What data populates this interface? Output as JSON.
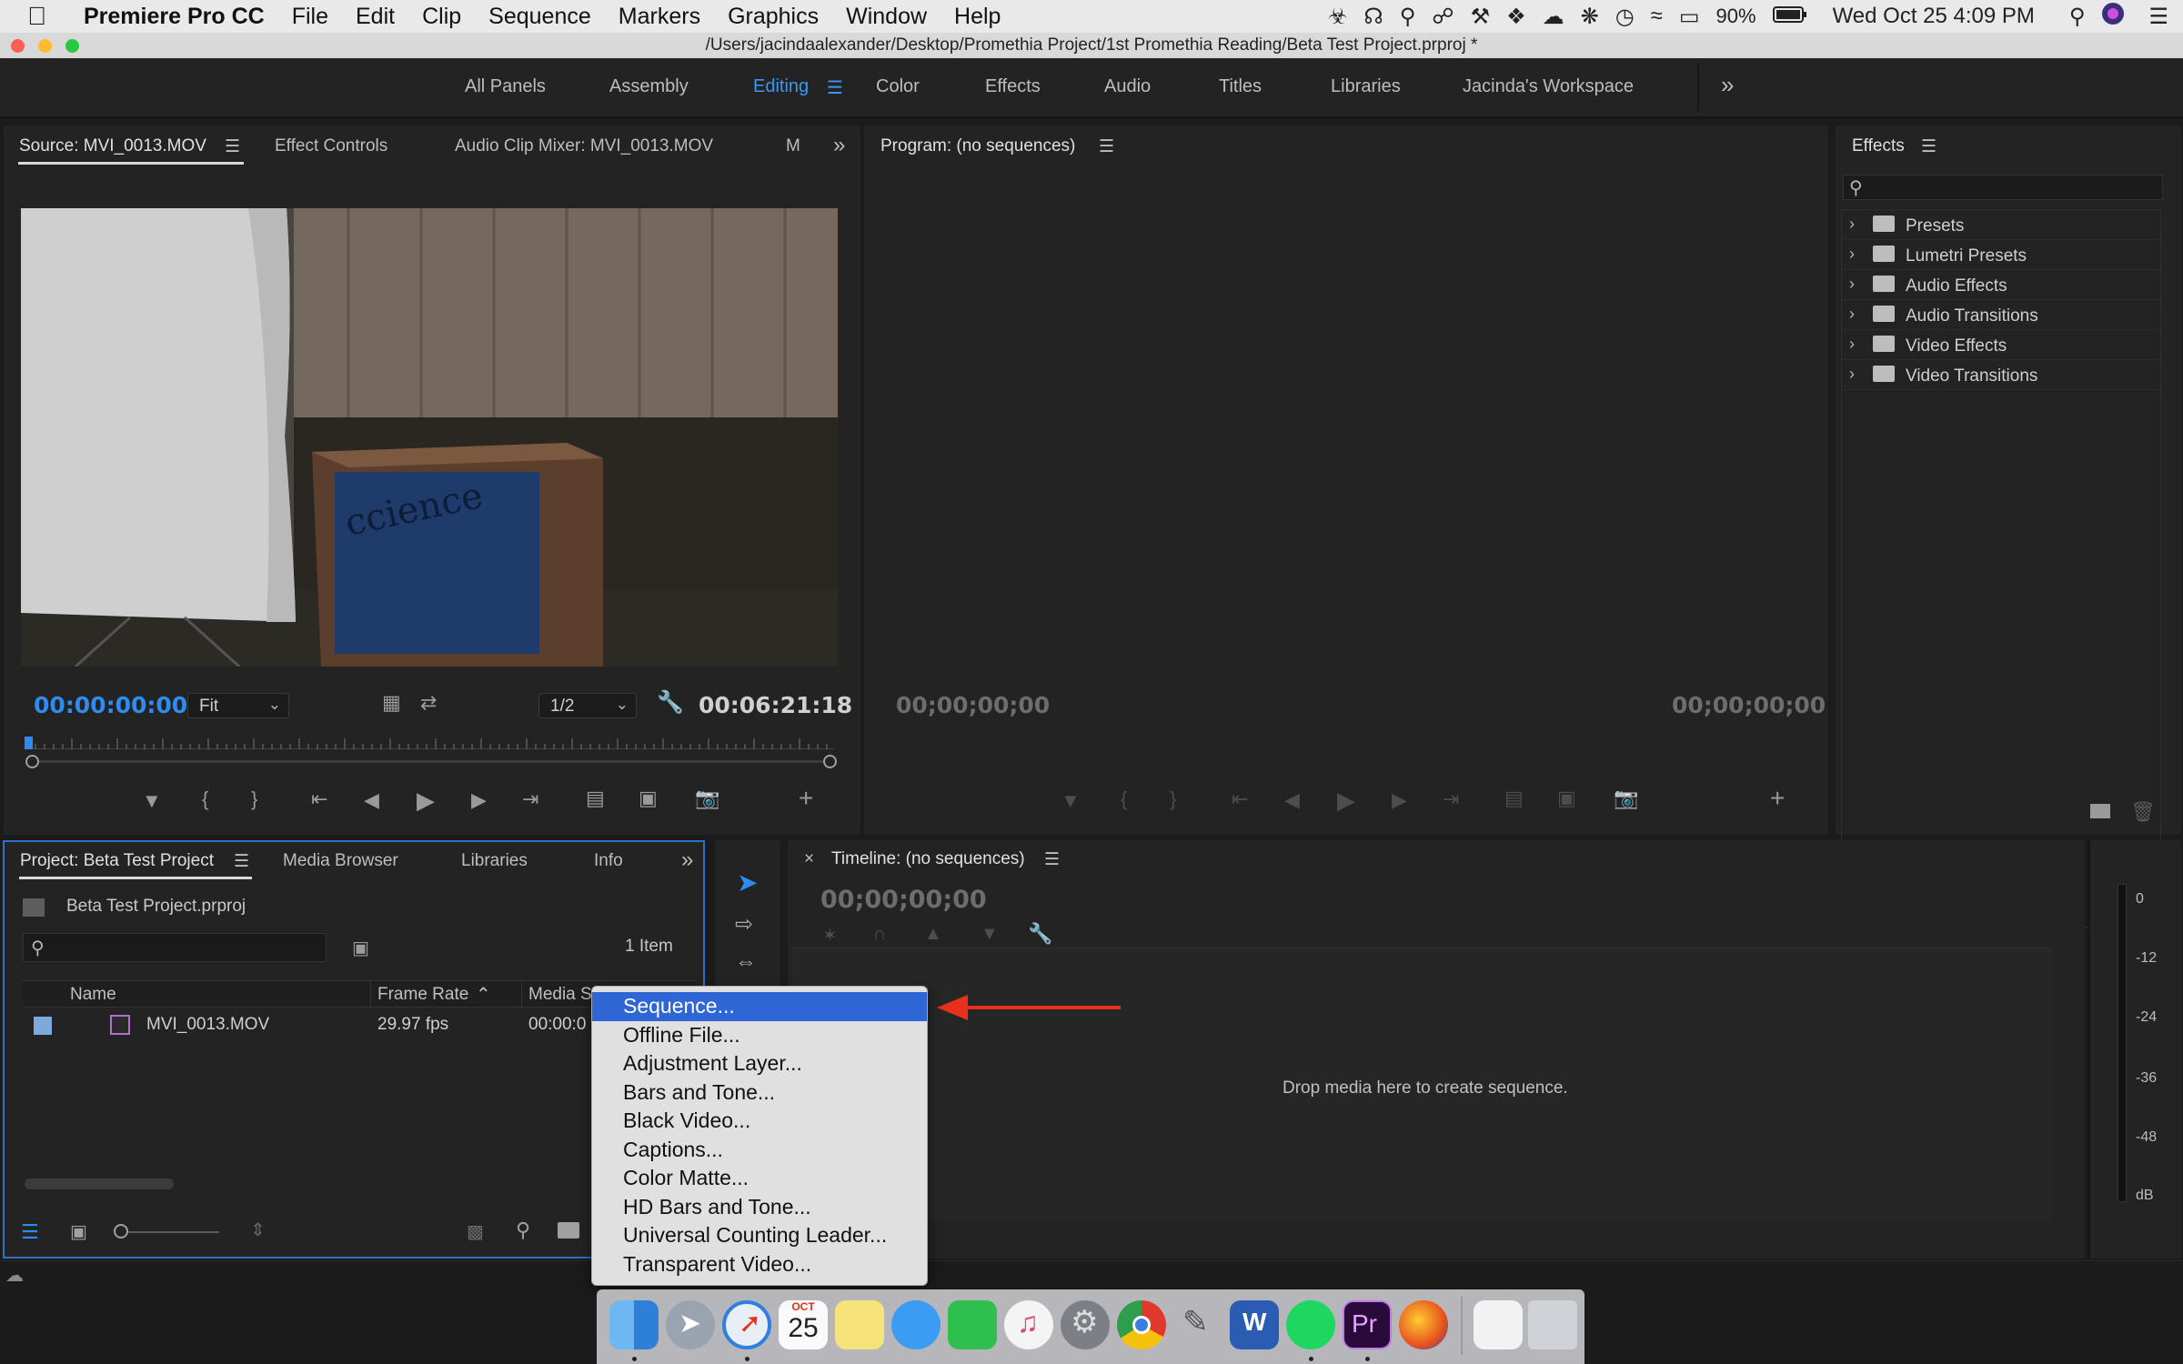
{
  "menubar": {
    "app_name": "Premiere Pro CC",
    "items": [
      "File",
      "Edit",
      "Clip",
      "Sequence",
      "Markers",
      "Graphics",
      "Window",
      "Help"
    ],
    "battery": "90%",
    "datetime": "Wed Oct 25  4:09 PM"
  },
  "window": {
    "title": "/Users/jacindaalexander/Desktop/Promethia Project/1st Promethia Reading/Beta Test Project.prproj *"
  },
  "workspaces": {
    "tabs": [
      "All Panels",
      "Assembly",
      "Editing",
      "Color",
      "Effects",
      "Audio",
      "Titles",
      "Libraries",
      "Jacinda's Workspace"
    ],
    "active": "Editing",
    "overflow": "»"
  },
  "source_panel": {
    "tabs": [
      "Source: MVI_0013.MOV",
      "Effect Controls",
      "Audio Clip Mixer: MVI_0013.MOV",
      "M"
    ],
    "timecode_current": "00:00:00:00",
    "zoom": "Fit",
    "resolution": "1/2",
    "timecode_duration": "00:06:21:18"
  },
  "program_panel": {
    "title": "Program: (no sequences)",
    "timecode_left": "00;00;00;00",
    "timecode_right": "00;00;00;00"
  },
  "effects_panel": {
    "title": "Effects",
    "items": [
      "Presets",
      "Lumetri Presets",
      "Audio Effects",
      "Audio Transitions",
      "Video Effects",
      "Video Transitions"
    ]
  },
  "project_panel": {
    "tabs": [
      "Project: Beta Test Project",
      "Media Browser",
      "Libraries",
      "Info"
    ],
    "file_name": "Beta Test Project.prproj",
    "item_count": "1 Item",
    "columns": [
      "Name",
      "Frame Rate",
      "Media St"
    ],
    "rows": [
      {
        "name": "MVI_0013.MOV",
        "frame_rate": "29.97 fps",
        "media_start": "00:00:0"
      }
    ]
  },
  "timeline_panel": {
    "title": "Timeline: (no sequences)",
    "timecode": "00;00;00;00",
    "drop_hint": "Drop media here to create sequence."
  },
  "audio_meter": {
    "labels": [
      "0",
      "-12",
      "-24",
      "-36",
      "-48",
      "dB"
    ]
  },
  "context_menu": {
    "items": [
      "Sequence...",
      "Offline File...",
      "Adjustment Layer...",
      "Bars and Tone...",
      "Black Video...",
      "Captions...",
      "Color Matte...",
      "HD Bars and Tone...",
      "Universal Counting Leader...",
      "Transparent Video..."
    ],
    "highlighted": "Sequence..."
  },
  "dock": {
    "apps": [
      "Finder",
      "Launchpad",
      "Safari",
      "Calendar",
      "Notes",
      "Messages",
      "FaceTime",
      "iTunes",
      "System Preferences",
      "Chrome",
      "Script Editor",
      "Word",
      "Spotify",
      "Premiere Pro",
      "Firefox",
      "Documents",
      "Trash"
    ],
    "calendar_month": "OCT",
    "calendar_day": "25",
    "premiere_label": "Pr",
    "word_label": "W"
  },
  "colors": {
    "accent_blue": "#2e8bf0",
    "menu_highlight": "#2e66d6",
    "annotation_arrow": "#e8301c"
  }
}
